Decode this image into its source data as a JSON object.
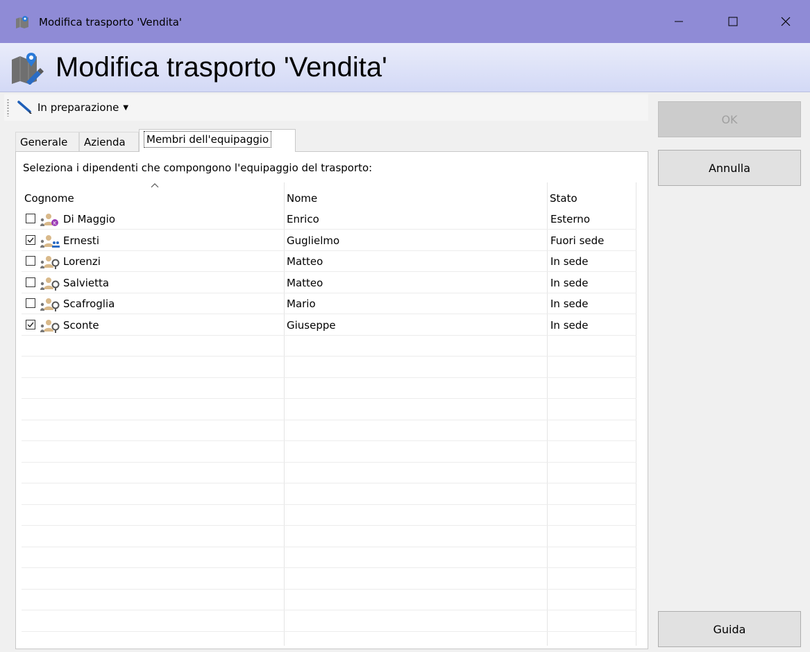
{
  "window": {
    "title": "Modifica trasporto 'Vendita'",
    "header_title": "Modifica trasporto 'Vendita'",
    "accent_color": "#8f8bd6"
  },
  "toolbar": {
    "status_label": "In preparazione",
    "status_icon": "pencil-icon"
  },
  "tabs": [
    {
      "label": "Generale",
      "active": false
    },
    {
      "label": "Azienda",
      "active": false
    },
    {
      "label": "Membri dell'equipaggio",
      "active": true
    }
  ],
  "crew": {
    "instruction": "Seleziona i dipendenti che compongono l'equipaggio del trasporto:",
    "columns": [
      "Cognome",
      "Nome",
      "Stato"
    ],
    "sorted_column": "Cognome",
    "rows": [
      {
        "cognome": "Di Maggio",
        "nome": "Enrico",
        "stato": "Esterno",
        "checked": false,
        "icon": "person-external-icon"
      },
      {
        "cognome": "Ernesti",
        "nome": "Guglielmo",
        "stato": "Fuori sede",
        "checked": true,
        "icon": "person-offsite-icon"
      },
      {
        "cognome": "Lorenzi",
        "nome": "Matteo",
        "stato": "In sede",
        "checked": false,
        "icon": "person-onsite-icon"
      },
      {
        "cognome": "Salvietta",
        "nome": "Matteo",
        "stato": "In sede",
        "checked": false,
        "icon": "person-onsite-icon"
      },
      {
        "cognome": "Scafroglia",
        "nome": "Mario",
        "stato": "In sede",
        "checked": false,
        "icon": "person-onsite-icon"
      },
      {
        "cognome": "Sconte",
        "nome": "Giuseppe",
        "stato": "In sede",
        "checked": true,
        "icon": "person-onsite-icon"
      }
    ]
  },
  "buttons": {
    "ok": "OK",
    "cancel": "Annulla",
    "help": "Guida"
  }
}
